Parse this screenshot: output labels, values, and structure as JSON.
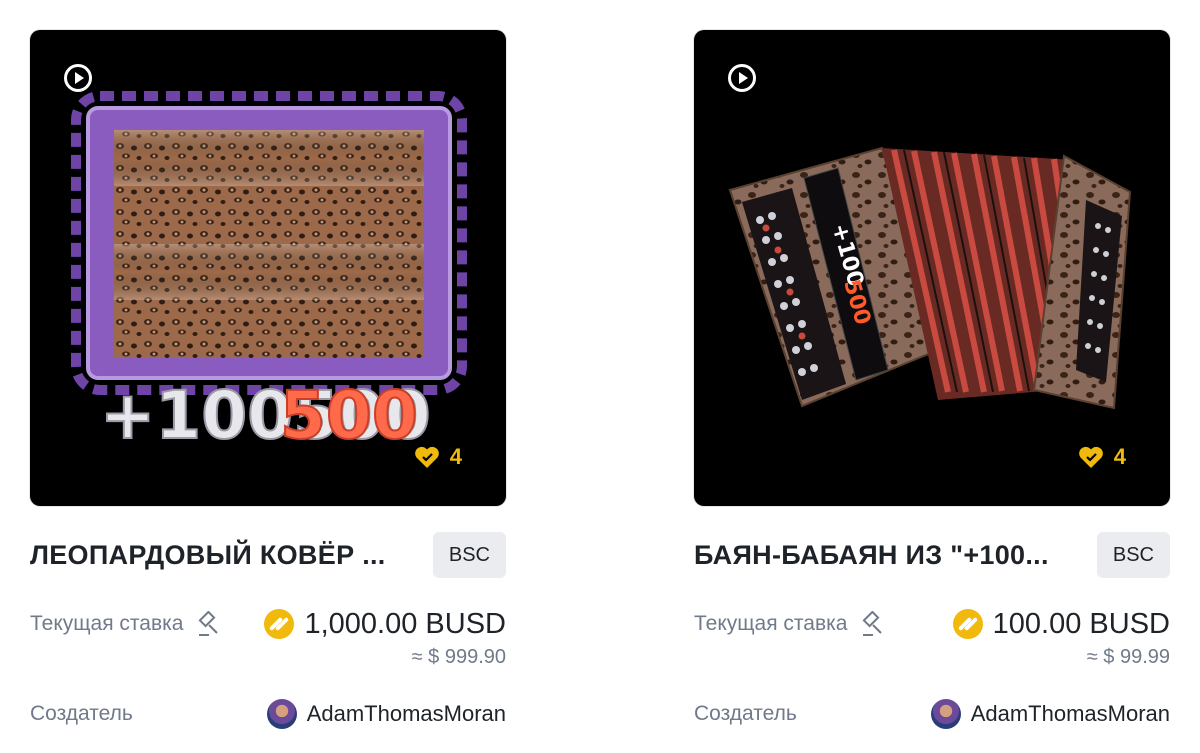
{
  "cards": [
    {
      "title": "ЛЕОПАРДОВЫЙ КОВЁР ...",
      "chain": "BSC",
      "likes": "4",
      "bid_label": "Текущая ставка",
      "price": "1,000.00 BUSD",
      "usd": "≈ $ 999.90",
      "creator_label": "Создатель",
      "creator": "AdamThomasMoran",
      "art_text": "+100500"
    },
    {
      "title": "БАЯН-БАБАЯН ИЗ \"+100...",
      "chain": "BSC",
      "likes": "4",
      "bid_label": "Текущая ставка",
      "price": "100.00 BUSD",
      "usd": "≈ $ 99.99",
      "creator_label": "Создатель",
      "creator": "AdamThomasMoran",
      "art_text": "+100500"
    }
  ],
  "colors": {
    "accent": "#f0b90b",
    "text": "#1e2329",
    "muted": "#707a8a",
    "chip_bg": "#eaecef"
  },
  "icons": [
    "play-icon",
    "heart-icon",
    "gavel-icon",
    "busd-coin-icon",
    "avatar"
  ]
}
